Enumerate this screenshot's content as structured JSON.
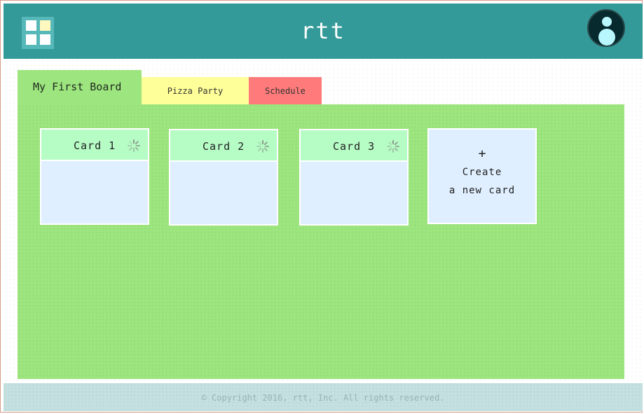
{
  "header": {
    "title": "rtt",
    "logo_icon": "grid-logo-icon",
    "avatar_icon": "user-avatar-icon"
  },
  "tabs": [
    {
      "label": "My First Board",
      "color": "#9de57e",
      "active": true
    },
    {
      "label": "Pizza Party",
      "color": "#ffff99",
      "active": false
    },
    {
      "label": "Schedule",
      "color": "#ff7b7b",
      "active": false
    }
  ],
  "cards": [
    {
      "title": "Card 1",
      "status_icon": "loading-spinner-icon"
    },
    {
      "title": "Card 2",
      "status_icon": "loading-spinner-icon"
    },
    {
      "title": "Card 3",
      "status_icon": "loading-spinner-icon"
    }
  ],
  "create_card": {
    "plus": "+",
    "line1": "Create",
    "line2": "a new card"
  },
  "footer": {
    "text": "© Copyright 2016, rtt, Inc. All rights reserved."
  },
  "colors": {
    "header_bg": "#349a99",
    "board_bg": "#9de57e",
    "card_head_bg": "#b6fcc5",
    "card_body_bg": "#e0efff",
    "footer_bg": "#c4e0e0"
  }
}
